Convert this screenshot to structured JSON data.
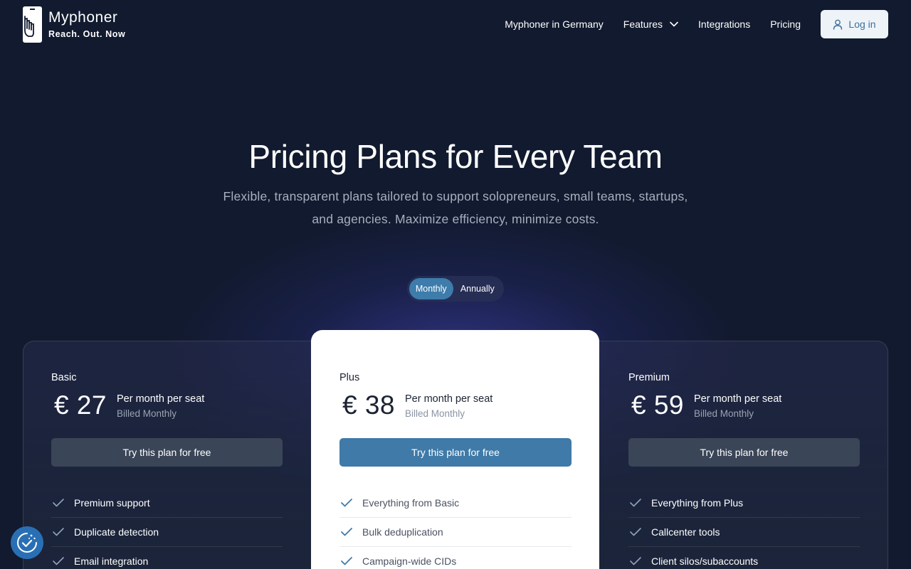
{
  "brand": {
    "name": "Myphoner",
    "tagline": "Reach. Out. Now"
  },
  "nav": {
    "items": [
      {
        "label": "Myphoner in Germany"
      },
      {
        "label": "Features"
      },
      {
        "label": "Integrations"
      },
      {
        "label": "Pricing"
      }
    ],
    "login_label": "Log in"
  },
  "hero": {
    "title": "Pricing Plans for Every Team",
    "subtitle_line1": "Flexible, transparent plans tailored to support solopreneurs, small teams, startups,",
    "subtitle_line2": "and agencies. Maximize efficiency, minimize costs."
  },
  "billing_toggle": {
    "monthly": "Monthly",
    "annually": "Annually",
    "selected": "Monthly"
  },
  "plans": [
    {
      "name": "Basic",
      "price": "€ 27",
      "per": "Per month per seat",
      "billed": "Billed Monthly",
      "cta": "Try this plan for free",
      "features": [
        "Premium support",
        "Duplicate detection",
        "Email integration"
      ]
    },
    {
      "name": "Plus",
      "price": "€ 38",
      "per": "Per month per seat",
      "billed": "Billed Monthly",
      "cta": "Try this plan for free",
      "features": [
        "Everything from Basic",
        "Bulk deduplication",
        "Campaign-wide CIDs"
      ]
    },
    {
      "name": "Premium",
      "price": "€ 59",
      "per": "Per month per seat",
      "billed": "Billed Monthly",
      "cta": "Try this plan for free",
      "features": [
        "Everything from Plus",
        "Callcenter tools",
        "Client silos/subaccounts"
      ]
    }
  ],
  "colors": {
    "background": "#111a2e",
    "accent": "#3d7cab",
    "cookie_button": "#2a6fb4"
  }
}
